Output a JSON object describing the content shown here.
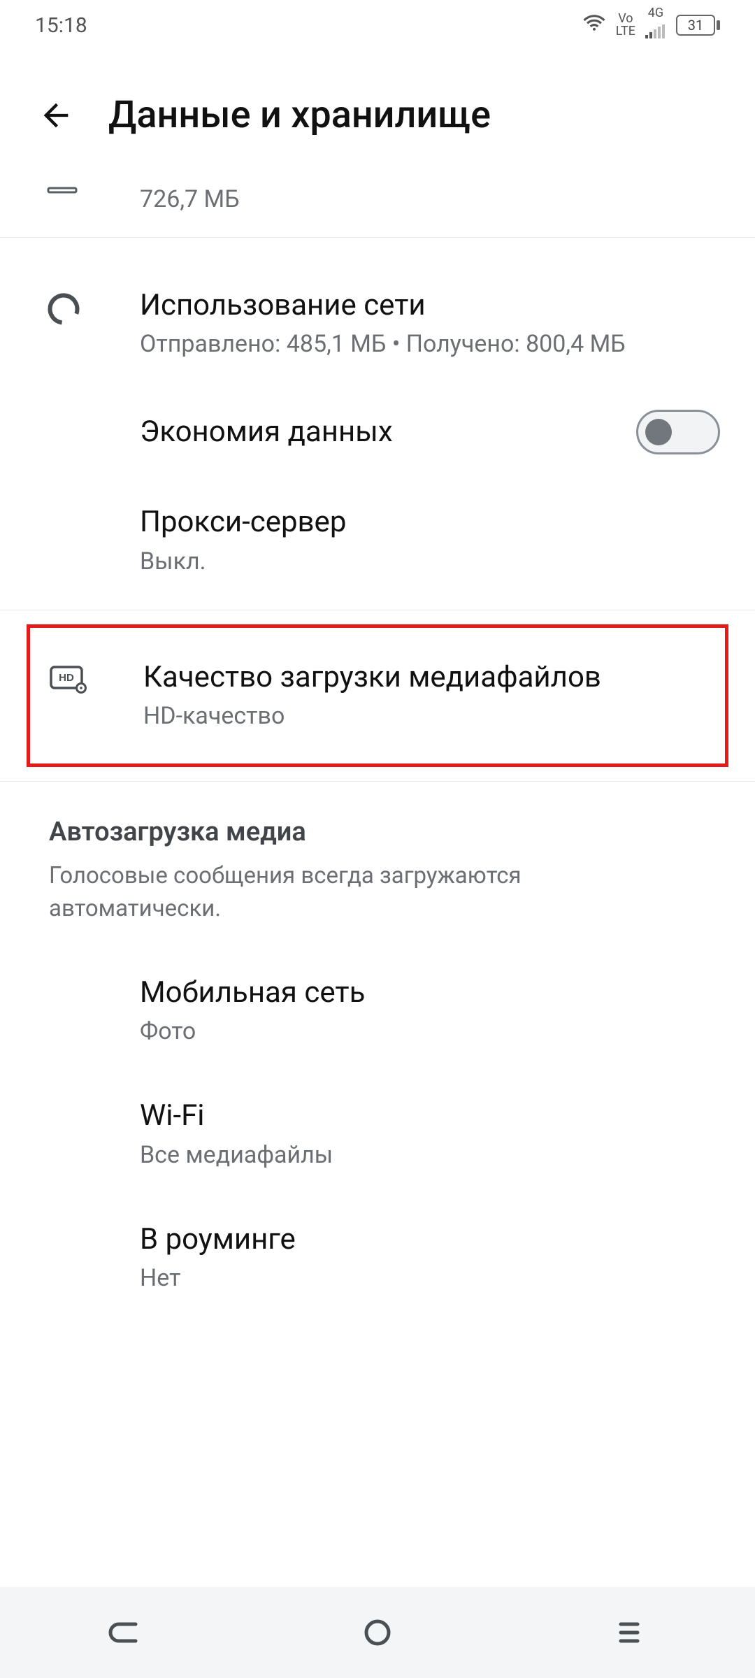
{
  "status": {
    "time": "15:18",
    "volte": "Vo\nLTE",
    "net": "4G",
    "battery": "31"
  },
  "header": {
    "title": "Данные и хранилище"
  },
  "partial": {
    "size": "726,7 МБ"
  },
  "network_usage": {
    "title": "Использование сети",
    "sub": "Отправлено: 485,1 МБ • Получено: 800,4 МБ"
  },
  "data_saver": {
    "title": "Экономия данных"
  },
  "proxy": {
    "title": "Прокси-сервер",
    "sub": "Выкл."
  },
  "media_quality": {
    "title": "Качество загрузки медиафайлов",
    "sub": "HD-качество"
  },
  "autodownload": {
    "section_title": "Автозагрузка медиа",
    "section_desc": "Голосовые сообщения всегда загружаются автоматически.",
    "mobile": {
      "title": "Мобильная сеть",
      "sub": "Фото"
    },
    "wifi": {
      "title": "Wi-Fi",
      "sub": "Все медиафайлы"
    },
    "roaming": {
      "title": "В роуминге",
      "sub": "Нет"
    }
  }
}
